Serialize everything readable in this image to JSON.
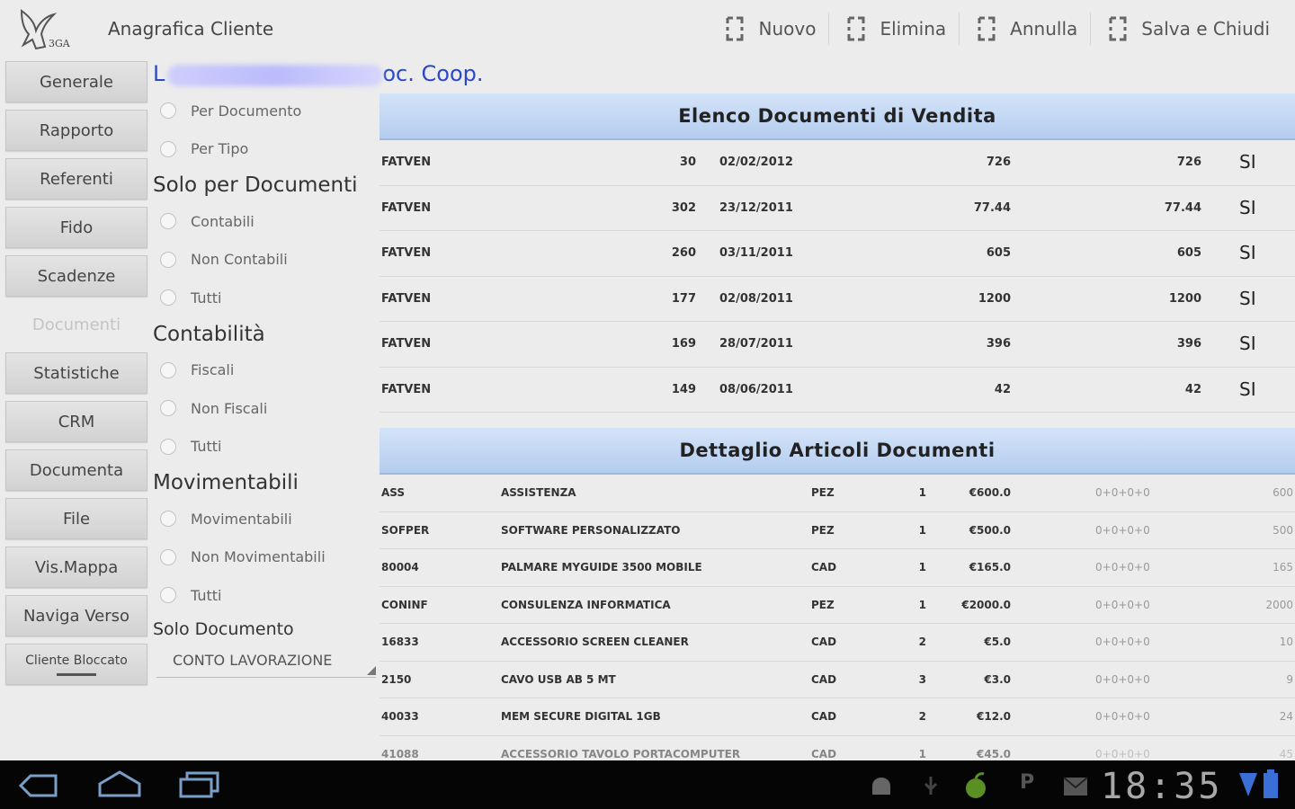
{
  "header": {
    "title": "Anagrafica Cliente",
    "actions": [
      "Nuovo",
      "Elimina",
      "Annulla",
      "Salva e Chiudi"
    ]
  },
  "sidebar": {
    "items": [
      "Generale",
      "Rapporto",
      "Referenti",
      "Fido",
      "Scadenze",
      "Documenti",
      "Statistiche",
      "CRM",
      "Documenta",
      "File",
      "Vis.Mappa",
      "Naviga Verso",
      "Cliente Bloccato"
    ],
    "active": "Documenti"
  },
  "customer": {
    "name_start": "L",
    "name_end": "oc. Coop."
  },
  "filters": {
    "order_options": [
      "Per Documento",
      "Per Tipo"
    ],
    "sections": [
      {
        "title": "Solo per Documenti",
        "options": [
          "Contabili",
          "Non Contabili",
          "Tutti"
        ]
      },
      {
        "title": "Contabilità",
        "options": [
          "Fiscali",
          "Non Fiscali",
          "Tutti"
        ]
      },
      {
        "title": "Movimentabili",
        "options": [
          "Movimentabili",
          "Non Movimentabili",
          "Tutti"
        ]
      }
    ],
    "solo_documento_label": "Solo Documento",
    "solo_documento_value": "CONTO LAVORAZIONE"
  },
  "sales": {
    "title": "Elenco Documenti di Vendita",
    "rows": [
      [
        "FATVEN",
        "30",
        "02/02/2012",
        "726",
        "726",
        "SI"
      ],
      [
        "FATVEN",
        "302",
        "23/12/2011",
        "77.44",
        "77.44",
        "SI"
      ],
      [
        "FATVEN",
        "260",
        "03/11/2011",
        "605",
        "605",
        "SI"
      ],
      [
        "FATVEN",
        "177",
        "02/08/2011",
        "1200",
        "1200",
        "SI"
      ],
      [
        "FATVEN",
        "169",
        "28/07/2011",
        "396",
        "396",
        "SI"
      ],
      [
        "FATVEN",
        "149",
        "08/06/2011",
        "42",
        "42",
        "SI"
      ]
    ]
  },
  "articles": {
    "title": "Dettaglio Articoli Documenti",
    "rows": [
      [
        "ASS",
        "ASSISTENZA",
        "PEZ",
        "1",
        "€600.0",
        "0+0+0+0",
        "600"
      ],
      [
        "SOFPER",
        "SOFTWARE PERSONALIZZATO",
        "PEZ",
        "1",
        "€500.0",
        "0+0+0+0",
        "500"
      ],
      [
        "80004",
        "PALMARE MYGUIDE 3500 MOBILE",
        "CAD",
        "1",
        "€165.0",
        "0+0+0+0",
        "165"
      ],
      [
        "CONINF",
        "CONSULENZA INFORMATICA",
        "PEZ",
        "1",
        "€2000.0",
        "0+0+0+0",
        "2000"
      ],
      [
        "16833",
        "ACCESSORIO SCREEN CLEANER",
        "CAD",
        "2",
        "€5.0",
        "0+0+0+0",
        "10"
      ],
      [
        "2150",
        "CAVO USB AB 5 MT",
        "CAD",
        "3",
        "€3.0",
        "0+0+0+0",
        "9"
      ],
      [
        "40033",
        "MEM SECURE DIGITAL 1GB",
        "CAD",
        "2",
        "€12.0",
        "0+0+0+0",
        "24"
      ],
      [
        "41088",
        "ACCESSORIO TAVOLO PORTACOMPUTER",
        "CAD",
        "1",
        "€45.0",
        "0+0+0+0",
        "45"
      ]
    ]
  },
  "statusbar": {
    "time": "18:35",
    "p_label": "P"
  },
  "icons": {
    "logo": "app-logo-bird",
    "action": "action-frame-icon",
    "back": "back-icon",
    "home": "home-icon",
    "recents": "recent-apps-icon",
    "android": "android-icon",
    "usb": "usb-icon",
    "apple": "apple-icon",
    "mail": "mail-icon",
    "signal": "signal-icon",
    "battery": "battery-icon"
  },
  "colors": {
    "accent_blue": "#2a48c9",
    "header_gradient_top": "#d4e3f8",
    "header_gradient_bottom": "#b4cdef",
    "navbar": "#050505"
  }
}
